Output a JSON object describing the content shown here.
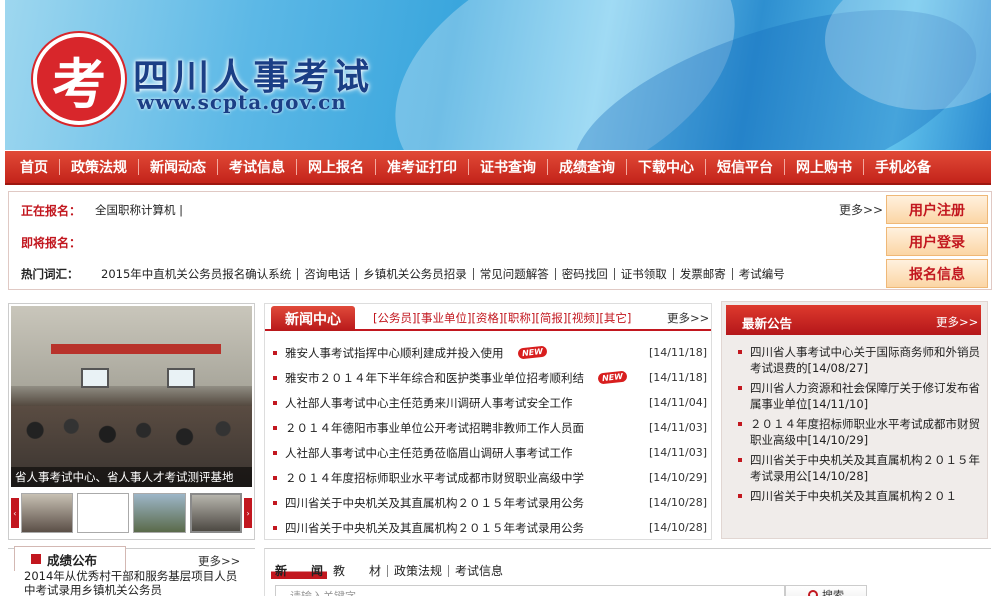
{
  "header": {
    "logo_char": "考",
    "title": "四川人事考试",
    "url": "www.scpta.gov.cn"
  },
  "nav": [
    "首页",
    "政策法规",
    "新闻动态",
    "考试信息",
    "网上报名",
    "准考证打印",
    "证书查询",
    "成绩查询",
    "下载中心",
    "短信平台",
    "网上购书",
    "手机必备"
  ],
  "info": {
    "registering_label": "正在报名：",
    "registering_text": "全国职称计算机  |",
    "upcoming_label": "即将报名：",
    "hot_label": "热门词汇：",
    "hot_words": [
      "2015年中直机关公务员报名确认系统",
      "咨询电话",
      "乡镇机关公务员招录",
      "常见问题解答",
      "密码找回",
      "证书领取",
      "发票邮寄",
      "考试编号"
    ],
    "more": "更多>>",
    "buttons": [
      "用户注册",
      "用户登录",
      "报名信息"
    ]
  },
  "slider": {
    "caption": "省人事考试中心、省人事人才考试测评基地",
    "left_arrow": "‹",
    "right_arrow": "›"
  },
  "news": {
    "tab": "新闻中心",
    "categories": "[公务员][事业单位][资格][职称][简报][视频][其它]",
    "more": "更多>>",
    "new_badge": "NEW",
    "items": [
      {
        "title": "雅安人事考试指挥中心顺利建成并投入使用",
        "date": "[14/11/18]",
        "new": true
      },
      {
        "title": "雅安市２０１４年下半年综合和医护类事业单位招考顺利结",
        "date": "[14/11/18]",
        "new": true
      },
      {
        "title": "人社部人事考试中心主任范勇来川调研人事考试安全工作",
        "date": "[14/11/04]",
        "new": false
      },
      {
        "title": "２０１４年德阳市事业单位公开考试招聘非教师工作人员面",
        "date": "[14/11/03]",
        "new": false
      },
      {
        "title": "人社部人事考试中心主任范勇莅临眉山调研人事考试工作",
        "date": "[14/11/03]",
        "new": false
      },
      {
        "title": "２０１４年度招标师职业水平考试成都市财贸职业高级中学",
        "date": "[14/10/29]",
        "new": false
      },
      {
        "title": "四川省关于中央机关及其直属机构２０１５年考试录用公务",
        "date": "[14/10/28]",
        "new": false
      },
      {
        "title": "四川省关于中央机关及其直属机构２０１５年考试录用公务",
        "date": "[14/10/28]",
        "new": false
      }
    ]
  },
  "notice": {
    "title": "最新公告",
    "more": "更多>>",
    "items": [
      "四川省人事考试中心关于国际商务师和外销员考试退费的[14/08/27]",
      "四川省人力资源和社会保障厅关于修订发布省属事业单位[14/11/10]",
      "２０１４年度招标师职业水平考试成都市财贸职业高级中[14/10/29]",
      "四川省关于中央机关及其直属机构２０１５年考试录用公[14/10/28]",
      "四川省关于中央机关及其直属机构２０１"
    ]
  },
  "scores": {
    "tab": "成绩公布",
    "more": "更多>>",
    "item": "2014年从优秀村干部和服务基层项目人员中考试录用乡镇机关公务员"
  },
  "search": {
    "tabs": [
      "新　　闻",
      "教　　材",
      "政策法规",
      "考试信息"
    ],
    "placeholder": "请输入关键字",
    "button": "搜索"
  }
}
